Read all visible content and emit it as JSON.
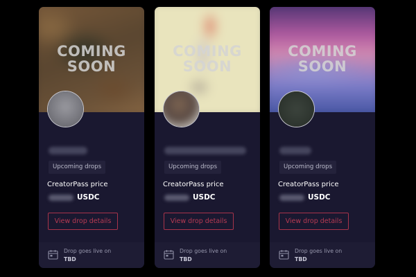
{
  "cards": [
    {
      "hero": {
        "line1": "COMING",
        "line2": "SOON"
      },
      "chip": "Upcoming drops",
      "price_label": "CreatorPass price",
      "currency": "USDC",
      "button": "View drop details",
      "live_label": "Drop goes live on",
      "live_value": "TBD"
    },
    {
      "hero": {
        "line1": "COMING",
        "line2": "SOON"
      },
      "chip": "Upcoming drops",
      "price_label": "CreatorPass price",
      "currency": "USDC",
      "button": "View drop details",
      "live_label": "Drop goes live on",
      "live_value": "TBD"
    },
    {
      "hero": {
        "line1": "COMING",
        "line2": "SOON"
      },
      "chip": "Upcoming drops",
      "price_label": "CreatorPass price",
      "currency": "USDC",
      "button": "View drop details",
      "live_label": "Drop goes live on",
      "live_value": "TBD"
    }
  ],
  "colors": {
    "page_background": "#000000",
    "card_background": "#1a1830",
    "button_accent": "#b73a52"
  },
  "icons": {
    "footer": "calendar-icon"
  }
}
